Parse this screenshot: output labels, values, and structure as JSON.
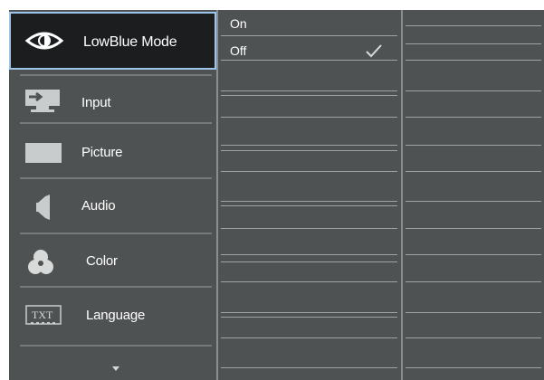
{
  "menu": {
    "items": [
      {
        "id": "lowblue",
        "label": "LowBlue Mode",
        "icon": "eye-icon",
        "selected": true
      },
      {
        "id": "input",
        "label": "Input",
        "icon": "input-icon",
        "selected": false
      },
      {
        "id": "picture",
        "label": "Picture",
        "icon": "picture-icon",
        "selected": false
      },
      {
        "id": "audio",
        "label": "Audio",
        "icon": "speaker-icon",
        "selected": false
      },
      {
        "id": "color",
        "label": "Color",
        "icon": "color-circles-icon",
        "selected": false
      },
      {
        "id": "language",
        "label": "Language",
        "icon": "txt-icon",
        "selected": false
      }
    ],
    "scroll_icon": "scroll-down-arrow-icon"
  },
  "submenu": {
    "options": [
      {
        "label": "On",
        "checked": false
      },
      {
        "label": "Off",
        "checked": true
      }
    ],
    "check_icon": "checkmark-icon"
  },
  "icons": {
    "language_icon_text": "TXT"
  },
  "colors": {
    "panel_bg": "#4e5252",
    "selected_bg": "#1b1d1e",
    "selected_border": "#9cc4e8",
    "divider": "#8a8e8e",
    "text": "#ffffff"
  }
}
